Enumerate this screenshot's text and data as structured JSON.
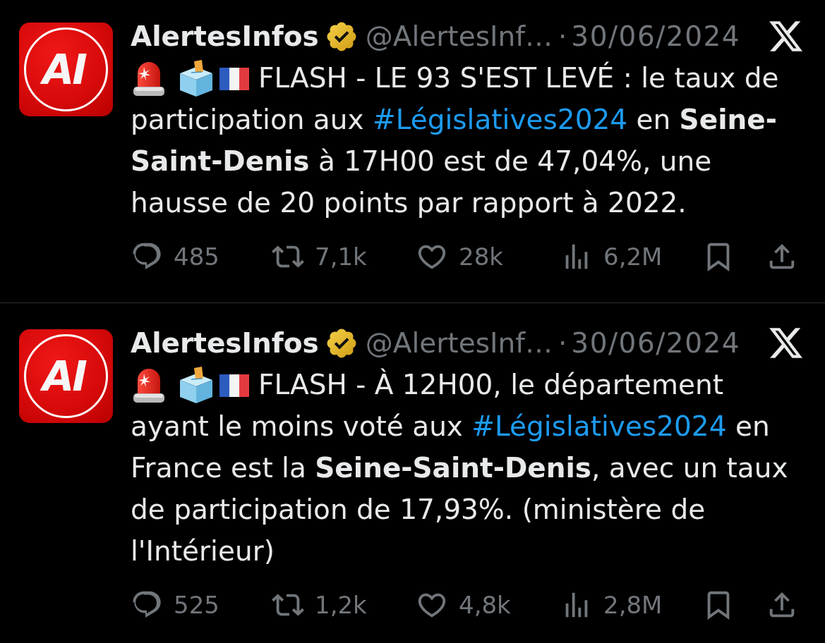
{
  "posts": [
    {
      "author": {
        "name": "AlertesInfos",
        "verified": true,
        "handle": "@AlertesInf…",
        "avatar_text": "AI"
      },
      "separator": "·",
      "date": "30/06/2024",
      "text": [
        {
          "kind": "text",
          "text": "FLASH - LE 93 S'EST LEVÉ : le taux de participation aux "
        },
        {
          "kind": "hashtag",
          "text": "#Législatives2024"
        },
        {
          "kind": "text",
          "text": " en **Seine-Saint-Denis** à 17H00 est de 47,04%, une hausse de 20 points par rapport à 2022."
        }
      ],
      "actions": [
        {
          "kind": "reply",
          "count": "485"
        },
        {
          "kind": "repost",
          "count": "7,1k"
        },
        {
          "kind": "like",
          "count": "28k"
        },
        {
          "kind": "views",
          "count": "6,2M"
        },
        {
          "kind": "bookmark"
        },
        {
          "kind": "share"
        }
      ]
    },
    {
      "author": {
        "name": "AlertesInfos",
        "verified": true,
        "handle": "@AlertesInf…",
        "avatar_text": "AI"
      },
      "separator": "·",
      "date": "30/06/2024",
      "text": [
        {
          "kind": "text",
          "text": "FLASH - À 12H00, le département ayant le moins voté aux "
        },
        {
          "kind": "hashtag",
          "text": "#Législatives2024"
        },
        {
          "kind": "text",
          "text": " en France est la **Seine-Saint-Denis**, avec un taux de participation de 17,93%. (ministère de l'Intérieur)"
        }
      ],
      "actions": [
        {
          "kind": "reply",
          "count": "525"
        },
        {
          "kind": "repost",
          "count": "1,2k"
        },
        {
          "kind": "like",
          "count": "4,8k"
        },
        {
          "kind": "views",
          "count": "2,8M"
        },
        {
          "kind": "bookmark"
        },
        {
          "kind": "share"
        }
      ]
    }
  ]
}
